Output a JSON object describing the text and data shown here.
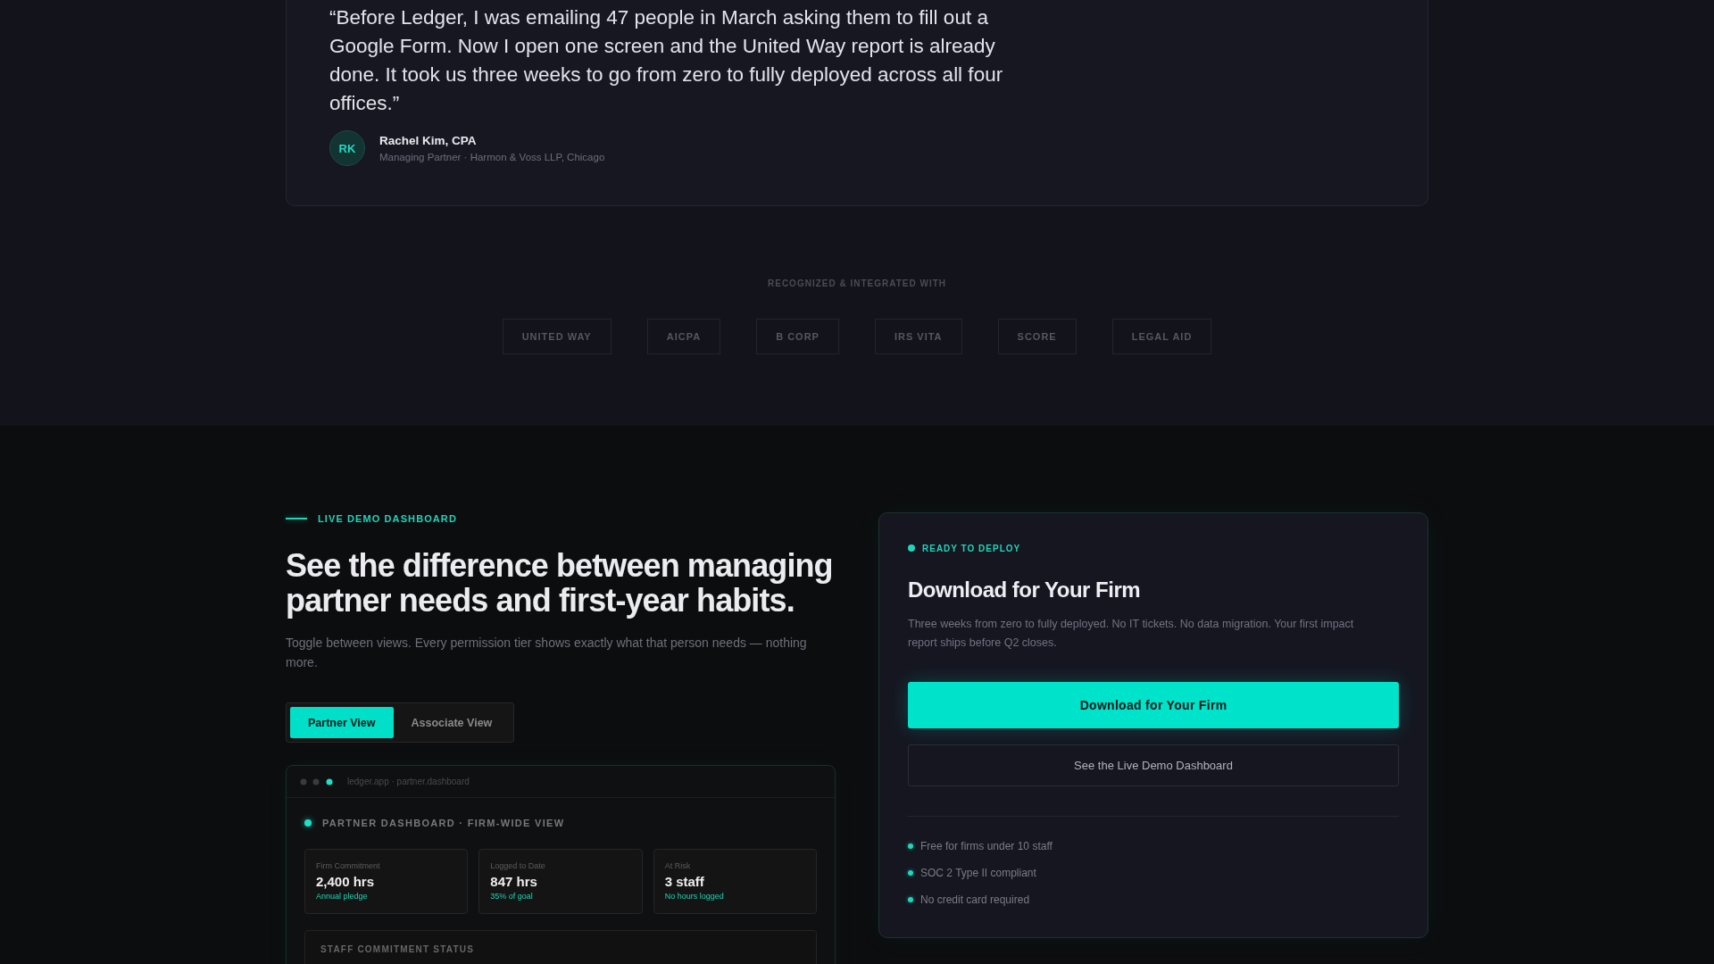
{
  "testimonial": {
    "quote": "“Before Ledger, I was emailing 47 people in March asking them to fill out a Google Form. Now I open one screen and the United Way report is already done. It took us three weeks to go from zero to fully deployed across all four offices.”",
    "author": {
      "initials": "RK",
      "name": "Rachel Kim, CPA",
      "role": "Managing Partner · Harmon & Voss LLP, Chicago"
    }
  },
  "recognition": {
    "label": "RECOGNIZED & INTEGRATED WITH",
    "partners": [
      "UNITED WAY",
      "AICPA",
      "B CORP",
      "IRS VITA",
      "SCORE",
      "LEGAL AID"
    ]
  },
  "demo": {
    "eyebrow": "LIVE DEMO DASHBOARD",
    "heading": "See the difference between managing partner needs and first-year habits.",
    "description": "Toggle between views. Every permission tier shows exactly what that person needs — nothing more.",
    "view_toggle": [
      {
        "label": "Partner View",
        "selected": true
      },
      {
        "label": "Associate View",
        "selected": false
      }
    ],
    "preview": {
      "url": "ledger.app · partner.dashboard",
      "title": "PARTNER DASHBOARD · FIRM-WIDE VIEW",
      "stats": [
        {
          "label": "Firm Commitment",
          "value": "2,400 hrs",
          "note": "Annual pledge"
        },
        {
          "label": "Logged to Date",
          "value": "847 hrs",
          "note": "35% of goal"
        },
        {
          "label": "At Risk",
          "value": "3 staff",
          "note": "No hours logged"
        }
      ],
      "staff_section": {
        "title": "STAFF COMMITMENT STATUS"
      }
    }
  },
  "download": {
    "status": "READY TO DEPLOY",
    "title": "Download for Your Firm",
    "description": "Three weeks from zero to fully deployed. No IT tickets. No data migration. Your first impact report ships before Q2 closes.",
    "primary_button": "Download for Your Firm",
    "secondary_button": "See the Live Demo Dashboard",
    "features": [
      "Free for firms under 10 staff",
      "SOC 2 Type II compliant",
      "No credit card required"
    ]
  }
}
